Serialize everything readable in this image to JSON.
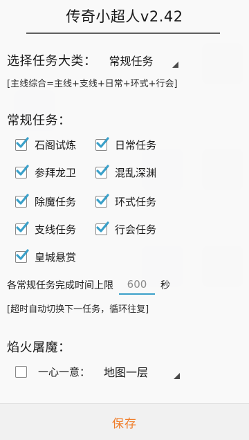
{
  "title": "传奇小超人v2.42",
  "category": {
    "label": "选择任务大类：",
    "selected": "常规任务",
    "hint": "[主线综合=主线+支线+日常+环式+行会]"
  },
  "regular": {
    "label": "常规任务：",
    "items": [
      {
        "label": "石阁试炼",
        "checked": true
      },
      {
        "label": "日常任务",
        "checked": true
      },
      {
        "label": "参拜龙卫",
        "checked": true
      },
      {
        "label": "混乱深渊",
        "checked": true
      },
      {
        "label": "除魔任务",
        "checked": true
      },
      {
        "label": "环式任务",
        "checked": true
      },
      {
        "label": "支线任务",
        "checked": true
      },
      {
        "label": "行会任务",
        "checked": true
      },
      {
        "label": "皇城悬赏",
        "checked": true
      }
    ]
  },
  "timeout": {
    "prefix": "各常规任务完成时间上限",
    "value": "600",
    "unit": "秒",
    "hint": "[超时自动切换下一任务，循环往复]"
  },
  "flame": {
    "label": "焰火屠魔：",
    "option_label": "一心一意：",
    "option_checked": false,
    "map_selected": "地图一层"
  },
  "save_label": "保存",
  "colors": {
    "check": "#3aa0c9",
    "save_text": "#f07c28",
    "input_underline": "#3aa0c9"
  }
}
